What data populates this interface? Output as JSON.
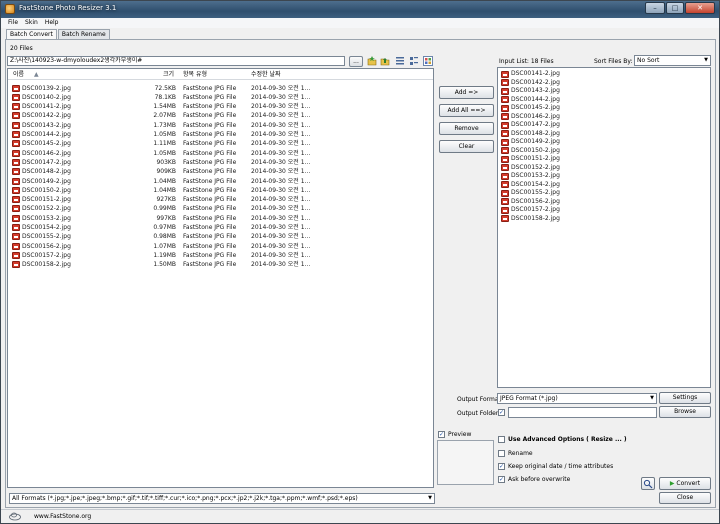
{
  "window": {
    "title": "FastStone Photo Resizer 3.1"
  },
  "title_buttons": [
    "–",
    "□",
    "✕"
  ],
  "menu": [
    "File",
    "Skin",
    "Help"
  ],
  "tabs": [
    "Batch Convert",
    "Batch Rename"
  ],
  "file_count": "20 Files",
  "path": "Z:\\사진\\140923-w-dmyoloudex2생각카부생이#",
  "browse_label": "...",
  "list_columns": [
    "이름",
    "크기",
    "항목 유형",
    "수정한 날짜"
  ],
  "files": [
    {
      "name": "DSC00139-2.jpg",
      "size": "72.5KB",
      "type": "FastStone JPG File",
      "date": "2014-09-30 오전 1..."
    },
    {
      "name": "DSC00140-2.jpg",
      "size": "78.1KB",
      "type": "FastStone JPG File",
      "date": "2014-09-30 오전 1..."
    },
    {
      "name": "DSC00141-2.jpg",
      "size": "1.54MB",
      "type": "FastStone JPG File",
      "date": "2014-09-30 오전 1..."
    },
    {
      "name": "DSC00142-2.jpg",
      "size": "2.07MB",
      "type": "FastStone JPG File",
      "date": "2014-09-30 오전 1..."
    },
    {
      "name": "DSC00143-2.jpg",
      "size": "1.73MB",
      "type": "FastStone JPG File",
      "date": "2014-09-30 오전 1..."
    },
    {
      "name": "DSC00144-2.jpg",
      "size": "1.05MB",
      "type": "FastStone JPG File",
      "date": "2014-09-30 오전 1..."
    },
    {
      "name": "DSC00145-2.jpg",
      "size": "1.11MB",
      "type": "FastStone JPG File",
      "date": "2014-09-30 오전 1..."
    },
    {
      "name": "DSC00146-2.jpg",
      "size": "1.05MB",
      "type": "FastStone JPG File",
      "date": "2014-09-30 오전 1..."
    },
    {
      "name": "DSC00147-2.jpg",
      "size": "903KB",
      "type": "FastStone JPG File",
      "date": "2014-09-30 오전 1..."
    },
    {
      "name": "DSC00148-2.jpg",
      "size": "909KB",
      "type": "FastStone JPG File",
      "date": "2014-09-30 오전 1..."
    },
    {
      "name": "DSC00149-2.jpg",
      "size": "1.04MB",
      "type": "FastStone JPG File",
      "date": "2014-09-30 오전 1..."
    },
    {
      "name": "DSC00150-2.jpg",
      "size": "1.04MB",
      "type": "FastStone JPG File",
      "date": "2014-09-30 오전 1..."
    },
    {
      "name": "DSC00151-2.jpg",
      "size": "927KB",
      "type": "FastStone JPG File",
      "date": "2014-09-30 오전 1..."
    },
    {
      "name": "DSC00152-2.jpg",
      "size": "0.99MB",
      "type": "FastStone JPG File",
      "date": "2014-09-30 오전 1..."
    },
    {
      "name": "DSC00153-2.jpg",
      "size": "997KB",
      "type": "FastStone JPG File",
      "date": "2014-09-30 오전 1..."
    },
    {
      "name": "DSC00154-2.jpg",
      "size": "0.97MB",
      "type": "FastStone JPG File",
      "date": "2014-09-30 오전 1..."
    },
    {
      "name": "DSC00155-2.jpg",
      "size": "0.98MB",
      "type": "FastStone JPG File",
      "date": "2014-09-30 오전 1..."
    },
    {
      "name": "DSC00156-2.jpg",
      "size": "1.07MB",
      "type": "FastStone JPG File",
      "date": "2014-09-30 오전 1..."
    },
    {
      "name": "DSC00157-2.jpg",
      "size": "1.19MB",
      "type": "FastStone JPG File",
      "date": "2014-09-30 오전 1..."
    },
    {
      "name": "DSC00158-2.jpg",
      "size": "1.50MB",
      "type": "FastStone JPG File",
      "date": "2014-09-30 오전 1..."
    }
  ],
  "actions": {
    "add": "Add =>",
    "add_all": "Add All ==>",
    "remove": "Remove",
    "clear": "Clear"
  },
  "input_list": {
    "label": "Input List: 18 Files",
    "sort_label": "Sort Files By:",
    "sort_value": "No Sort",
    "items": [
      "DSC00141-2.jpg",
      "DSC00142-2.jpg",
      "DSC00143-2.jpg",
      "DSC00144-2.jpg",
      "DSC00145-2.jpg",
      "DSC00146-2.jpg",
      "DSC00147-2.jpg",
      "DSC00148-2.jpg",
      "DSC00149-2.jpg",
      "DSC00150-2.jpg",
      "DSC00151-2.jpg",
      "DSC00152-2.jpg",
      "DSC00153-2.jpg",
      "DSC00154-2.jpg",
      "DSC00155-2.jpg",
      "DSC00156-2.jpg",
      "DSC00157-2.jpg",
      "DSC00158-2.jpg"
    ]
  },
  "output": {
    "format_label": "Output Format:",
    "format_value": "JPEG Format (*.jpg)",
    "settings": "Settings",
    "folder_label": "Output Folder:",
    "folder_value": "",
    "browse": "Browse"
  },
  "preview_label": "Preview",
  "options": {
    "advanced": "Use Advanced Options ( Resize ... )",
    "rename": "Rename",
    "keep_date": "Keep original date / time attributes",
    "ask_overwrite": "Ask before overwrite"
  },
  "convert": "Convert",
  "close": "Close",
  "filter_value": "All Formats (*.jpg;*.jpe;*.jpeg;*.bmp;*.gif;*.tif;*.tiff;*.cur;*.ico;*.png;*.pcx;*.jp2;*.j2k;*.tga;*.ppm;*.wmf;*.psd;*.eps)",
  "website": "www.FastStone.org",
  "colors": {
    "accent": "#2f4f6e",
    "jpg_icon": "#d33b2c",
    "convert_green": "#2e9e2e"
  }
}
